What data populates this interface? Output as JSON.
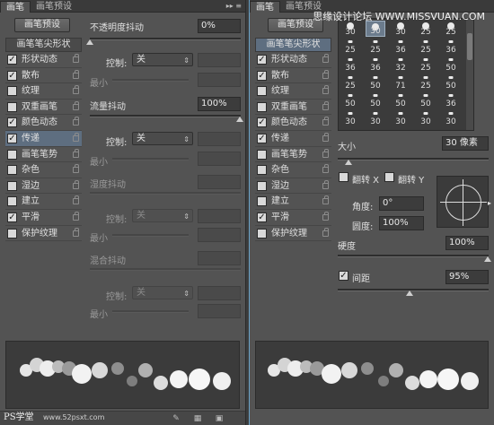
{
  "tabs": {
    "brush": "画笔",
    "brush_presets": "画笔预设"
  },
  "presets_button": "画笔预设",
  "list": {
    "header": "画笔笔尖形状",
    "items": [
      {
        "label": "形状动态",
        "checked": true
      },
      {
        "label": "散布",
        "checked": true
      },
      {
        "label": "纹理",
        "checked": false
      },
      {
        "label": "双重画笔",
        "checked": false
      },
      {
        "label": "颜色动态",
        "checked": true
      },
      {
        "label": "传递",
        "checked": true
      },
      {
        "label": "画笔笔势",
        "checked": false
      },
      {
        "label": "杂色",
        "checked": false
      },
      {
        "label": "湿边",
        "checked": false
      },
      {
        "label": "建立",
        "checked": false
      },
      {
        "label": "平滑",
        "checked": true
      },
      {
        "label": "保护纹理",
        "checked": false
      }
    ]
  },
  "left": {
    "opacity_jitter_label": "不透明度抖动",
    "opacity_jitter_value": "0%",
    "control_label": "控制:",
    "control_value": "关",
    "minimum_label": "最小",
    "flow_jitter_label": "流量抖动",
    "flow_jitter_value": "100%",
    "wetness_jitter_label": "湿度抖动",
    "mix_jitter_label": "混合抖动",
    "control_label2": "控制:",
    "control_value2": "关",
    "control_label3": "控制:",
    "control_value3": "关",
    "control_label4": "控制:",
    "control_value4": "关",
    "minimum_label2": "最小",
    "minimum_label3": "最小",
    "minimum_label4": "最小"
  },
  "right": {
    "brush_grid": [
      [
        "30",
        "30",
        "30",
        "25",
        "25"
      ],
      [
        "25",
        "25",
        "36",
        "25",
        "36"
      ],
      [
        "36",
        "36",
        "32",
        "25",
        "50"
      ],
      [
        "25",
        "50",
        "71",
        "25",
        "50"
      ],
      [
        "50",
        "50",
        "50",
        "50",
        "36"
      ],
      [
        "30",
        "30",
        "30",
        "30",
        "30"
      ]
    ],
    "size_label": "大小",
    "size_value": "30 像素",
    "flip_x_label": "翻转 X",
    "flip_y_label": "翻转 Y",
    "angle_label": "角度:",
    "angle_value": "0°",
    "roundness_label": "圆度:",
    "roundness_value": "100%",
    "hardness_label": "硬度",
    "hardness_value": "100%",
    "spacing_label": "间距",
    "spacing_value": "95%",
    "spacing_checked": true
  },
  "watermark": {
    "top": "思缘设计论坛 WWW.MISSVUAN.COM",
    "bottom_left": "PS学堂",
    "bottom_url": "www.52psxt.com"
  }
}
